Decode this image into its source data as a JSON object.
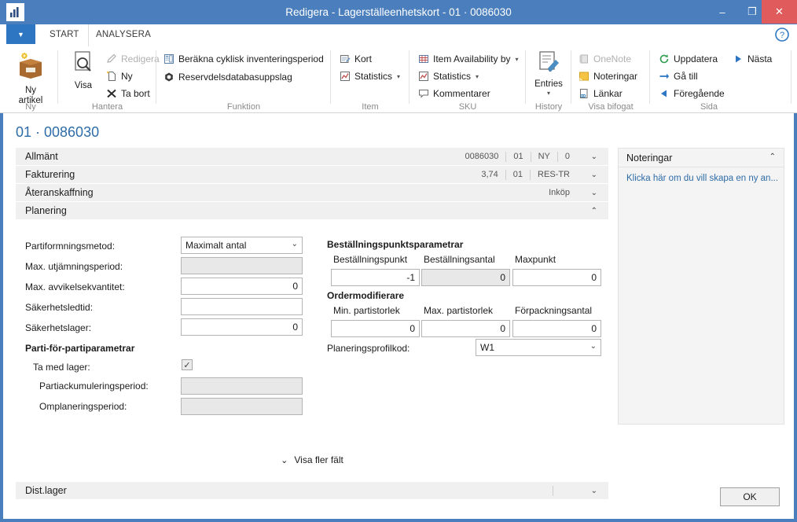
{
  "window": {
    "title": "Redigera - Lagerställeenhetskort - 01 · 0086030",
    "app_icon": "chart-icon",
    "minimize": "–",
    "maximize": "❐",
    "close": "✕"
  },
  "tabs": {
    "file_menu": "▼",
    "items": [
      {
        "label": "START",
        "active": true
      },
      {
        "label": "ANALYSERA",
        "active": false
      }
    ],
    "help": "?"
  },
  "ribbon": {
    "groups": [
      {
        "name": "Ny",
        "label": "Ny",
        "big_buttons": [
          {
            "label": "Ny\nartikel",
            "icon": "new-item-box-icon"
          }
        ],
        "items": []
      },
      {
        "name": "Hantera",
        "label": "Hantera",
        "big_buttons": [
          {
            "label": "Visa",
            "icon": "view-magnifier-icon"
          }
        ],
        "items": [
          {
            "label": "Redigera",
            "icon": "pencil-icon",
            "disabled": true
          },
          {
            "label": "Ny",
            "icon": "new-page-icon",
            "disabled": false
          },
          {
            "label": "Ta bort",
            "icon": "delete-x-icon",
            "disabled": false
          }
        ]
      },
      {
        "name": "Funktion",
        "label": "Funktion",
        "big_buttons": [],
        "items": [
          {
            "label": "Beräkna cyklisk inventeringsperiod",
            "icon": "calculator-icon",
            "disabled": false
          },
          {
            "label": "Reservdelsdatabasuppslag",
            "icon": "hexagon-icon",
            "disabled": false
          }
        ]
      },
      {
        "name": "Item",
        "label": "Item",
        "big_buttons": [],
        "items": [
          {
            "label": "Kort",
            "icon": "card-icon",
            "disabled": false
          },
          {
            "label": "Statistics",
            "icon": "statistics-chart-icon",
            "disabled": false,
            "dropdown": true
          }
        ]
      },
      {
        "name": "SKU",
        "label": "SKU",
        "big_buttons": [],
        "items": [
          {
            "label": "Item Availability by",
            "icon": "availability-grid-icon",
            "disabled": false,
            "dropdown": true
          },
          {
            "label": "Statistics",
            "icon": "statistics-chart-icon",
            "disabled": false,
            "dropdown": true
          },
          {
            "label": "Kommentarer",
            "icon": "comment-bubble-icon",
            "disabled": false
          }
        ]
      },
      {
        "name": "History",
        "label": "History",
        "big_buttons": [
          {
            "label": "Entries",
            "icon": "entries-pencil-icon",
            "dropdown": true
          }
        ],
        "items": []
      },
      {
        "name": "Visa bifogat",
        "label": "Visa bifogat",
        "big_buttons": [],
        "items": [
          {
            "label": "OneNote",
            "icon": "onenote-icon",
            "disabled": true
          },
          {
            "label": "Noteringar",
            "icon": "notes-icon",
            "disabled": false
          },
          {
            "label": "Länkar",
            "icon": "links-icon",
            "disabled": false
          }
        ]
      },
      {
        "name": "Sida",
        "label": "Sida",
        "big_buttons": [],
        "items": [
          {
            "label": "Uppdatera",
            "icon": "refresh-icon",
            "disabled": false
          },
          {
            "label": "Gå till",
            "icon": "goto-arrow-icon",
            "disabled": false
          },
          {
            "label": "Föregående",
            "icon": "prev-triangle-icon",
            "disabled": false
          },
          {
            "label": "Nästa",
            "icon": "next-triangle-icon",
            "disabled": false
          }
        ]
      }
    ]
  },
  "page": {
    "title": "01 · 0086030"
  },
  "fasttabs": [
    {
      "title": "Allmänt",
      "values": [
        "0086030",
        "01",
        "NY",
        "0"
      ],
      "expanded": false,
      "chevron": "⌄"
    },
    {
      "title": "Fakturering",
      "values": [
        "3,74",
        "01",
        "RES-TR"
      ],
      "expanded": false,
      "chevron": "⌄"
    },
    {
      "title": "Återanskaffning",
      "values": [
        "Inköp"
      ],
      "expanded": false,
      "chevron": "⌄"
    },
    {
      "title": "Planering",
      "values": [],
      "expanded": true,
      "chevron": "⌃"
    }
  ],
  "planering": {
    "left": {
      "labels": {
        "partiformningsmetod": "Partiformningsmetod:",
        "max_utjamningsperiod": "Max. utjämningsperiod:",
        "max_avvikelsekvantitet": "Max. avvikelsekvantitet:",
        "sakerhetsledtid": "Säkerhetsledtid:",
        "sakerhetslager": "Säkerhetslager:",
        "parti_header": "Parti-för-partiparametrar",
        "ta_med_lager": "Ta med lager:",
        "partiackumuleringsperiod": "Partiackumuleringsperiod:",
        "omplaneringsperiod": "Omplaneringsperiod:"
      },
      "values": {
        "partiformningsmetod": "Maximalt antal",
        "max_utjamningsperiod": "",
        "max_avvikelsekvantitet": "0",
        "sakerhetsledtid": "",
        "sakerhetslager": "0",
        "ta_med_lager_checked": "✓",
        "partiackumuleringsperiod": "",
        "omplaneringsperiod": ""
      }
    },
    "right": {
      "bestallningspunktsparametrar_header": "Beställningspunktsparametrar",
      "ordermodifierare_header": "Ordermodifierare",
      "columns_row1": [
        "Beställningspunkt",
        "Beställningsantal",
        "Maxpunkt"
      ],
      "values_row1": [
        "-1",
        "0",
        "0"
      ],
      "columns_row2": [
        "Min. partistorlek",
        "Max. partistorlek",
        "Förpackningsantal"
      ],
      "values_row2": [
        "0",
        "0",
        "0"
      ],
      "planeringsprofilkod_label": "Planeringsprofilkod:",
      "planeringsprofilkod_value": "W1"
    },
    "show_more": "Visa fler fält",
    "show_more_chevron": "⌄"
  },
  "distlager": {
    "title": "Dist.lager",
    "chevron": "⌄"
  },
  "notes_pane": {
    "title": "Noteringar",
    "chevron": "⌃",
    "link": "Klicka här om du vill skapa en ny an..."
  },
  "footer": {
    "ok": "OK"
  },
  "colors": {
    "title_bar": "#4a7ebc",
    "close_button": "#e05b5b",
    "accent_blue": "#2e76c2",
    "link_blue": "#2e6ca8",
    "fasttab_bg": "#f0f0f0"
  }
}
